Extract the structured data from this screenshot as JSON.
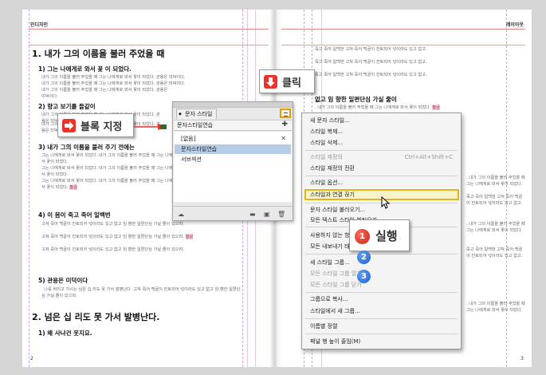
{
  "document": {
    "left_runhead": "인디자인",
    "right_runhead": "레이아웃",
    "left_page_number": "2",
    "right_page_number": "3",
    "left": {
      "h1_a": "1. 내가 그의 이름을 불러 주었을 때",
      "h2_1": "1) 그는 나에게로 와서 꽃 이 되었다.",
      "p1": "내가 그의 이름을 불러 주었을 때 그는 나에게로 와서 꽃이 되었다. 관용은 미덕이다.",
      "h2_2": "2) 향고 보기를 들같이",
      "h2_3": "3) 내가 그의 이름을 불러 주기 전에는",
      "p3": "그는 나에게로 와서 꽃이 되었다. 내가 그의 이름을 불러 주었을 때 그는 나에게로 와서 꽃이 되었다.",
      "h2_4": "4) 이 몸이 죽고 죽어 일백번",
      "p4": "고쳐 죽어 백골이 진토되어 넋이라도 있고 없고 임 향한 일편단심 가실 줄이 있으랴.",
      "h2_5": "5) 관용은 미덕이다",
      "p5": ". 나를 버리고 가시는 님은 십 리도 못 가서 발병난다.",
      "h1_b": "2. 넘은 십 리도 못 가서 발병난다.",
      "h2_6": "1) 왜 사냐건 웃지요.",
      "hl_word": "황금"
    },
    "right": {
      "p_top": "죽고 죽어 일백번 고쳐 죽어 백골이 진토되어 넋이라도 있고 없고.",
      "h2_r": "없고 임 향한 일편단심 가실 줄이",
      "p_r": ". 내가 그의 이름을 불러 주었을 때 그는 나에게로 와서 꽃이 되었다."
    }
  },
  "callouts": {
    "click": "클릭",
    "block": "블록 지정",
    "run": "실행"
  },
  "panel": {
    "tab": "문자 스타일",
    "header_row": "문자스타일연습",
    "items": [
      "[없음]",
      "문자스타일연습",
      "서브섹션"
    ]
  },
  "menu": {
    "items": [
      {
        "label": "새 문자 스타일...",
        "disabled": false
      },
      {
        "label": "스타일 복제...",
        "disabled": false
      },
      {
        "label": "스타일 삭제...",
        "disabled": false
      },
      {
        "label": "스타일 재정의",
        "disabled": true,
        "shortcut": "Ctrl+Alt+Shift+C"
      },
      {
        "label": "스타일 재정의 전환",
        "disabled": false
      },
      {
        "label": "스타일 옵션...",
        "disabled": false
      },
      {
        "label": "스타일과 연결 끊기",
        "disabled": false
      },
      {
        "label": "문자 스타일 불러오기...",
        "disabled": false
      },
      {
        "label": "모든 텍스트 스타일 불러오기...",
        "disabled": false
      },
      {
        "label": "사용하지 않는 항목 모두 선택",
        "disabled": false
      },
      {
        "label": "모든 내보내기 태그 편집...",
        "disabled": false
      },
      {
        "label": "새 스타일 그룹...",
        "disabled": false
      },
      {
        "label": "모든 스타일 그룹 열기",
        "disabled": true
      },
      {
        "label": "모든 스타일 그룹 닫기",
        "disabled": true
      },
      {
        "label": "그룹으로 복사...",
        "disabled": false
      },
      {
        "label": "스타일에서 새 그룹...",
        "disabled": false
      },
      {
        "label": "이름별 정렬",
        "disabled": false
      },
      {
        "label": "패널 행 높이 줄임(M)",
        "disabled": false
      }
    ]
  },
  "badges": {
    "one": "1",
    "two": "2",
    "three": "3"
  },
  "colors": {
    "accent_red": "#e8322c",
    "highlight_yellow": "#e3b51a",
    "selected_row": "#b7cce6"
  }
}
